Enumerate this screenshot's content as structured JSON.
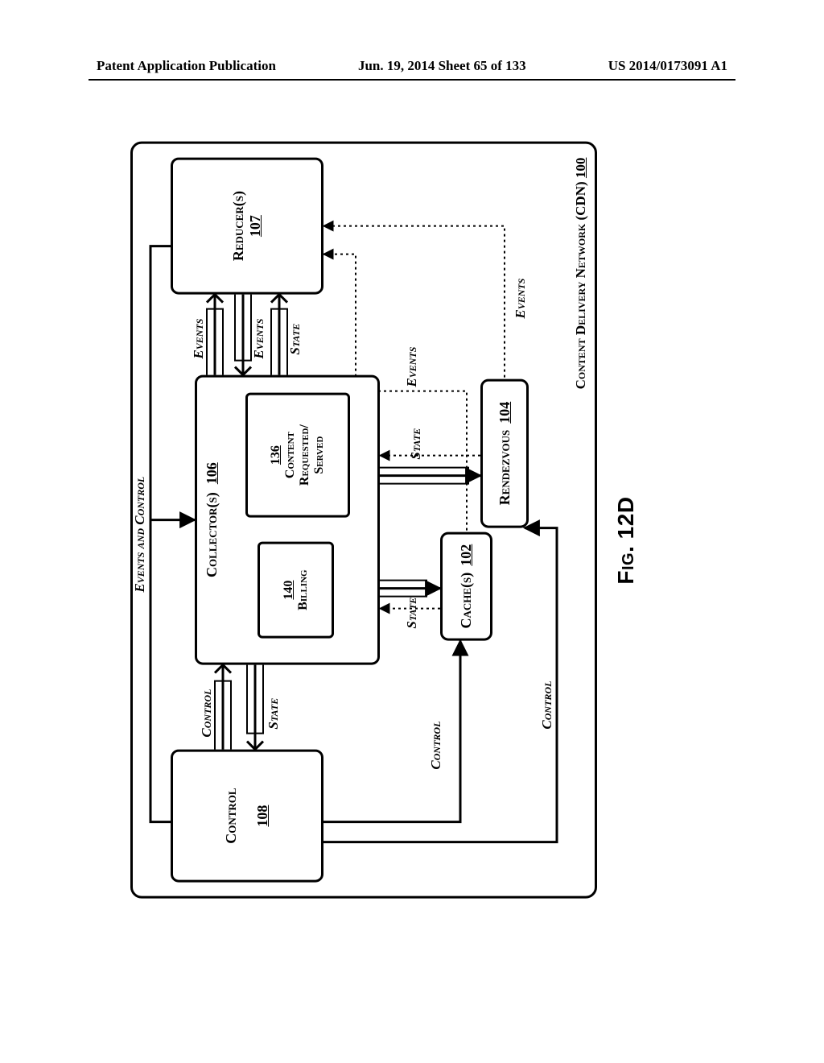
{
  "header": {
    "left": "Patent Application Publication",
    "center": "Jun. 19, 2014  Sheet 65 of 133",
    "right": "US 2014/0173091 A1"
  },
  "figure_caption": "Fig. 12D",
  "cdn": {
    "label": "Content Delivery Network (CDN)",
    "num": "100"
  },
  "boxes": {
    "control": {
      "title": "Control",
      "num": "108"
    },
    "collectors": {
      "title": "Collector(s)",
      "num": "106"
    },
    "reducers": {
      "title": "Reducer(s)",
      "num": "107"
    },
    "caches": {
      "title": "Cache(s)",
      "num": "102"
    },
    "rendezvous": {
      "title": "Rendezvous",
      "num": "104"
    },
    "billing": {
      "title": "Billing",
      "num": "140"
    },
    "content": {
      "title_l1": "Content",
      "title_l2": "Requested/",
      "title_l3": "Served",
      "num": "136"
    }
  },
  "labels": {
    "events_and_control": "Events and Control",
    "control": "Control",
    "state": "State",
    "events": "Events"
  }
}
